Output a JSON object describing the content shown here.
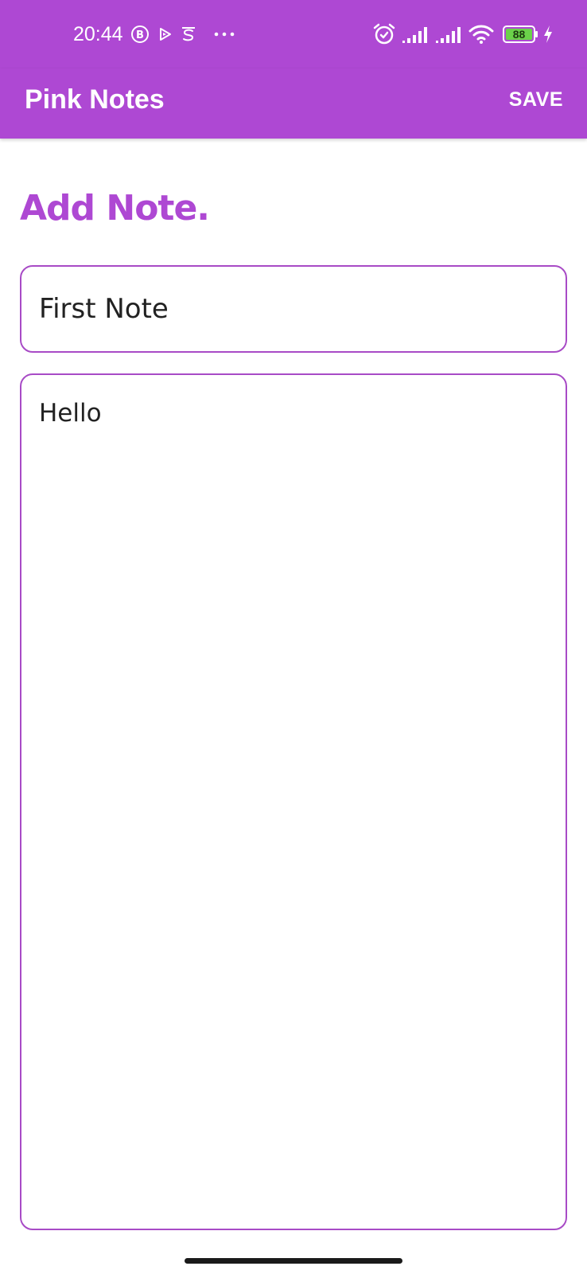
{
  "status_bar": {
    "time": "20:44",
    "battery_level": "88",
    "left_icons": [
      "b-circle-icon",
      "play-store-icon",
      "s-app-icon",
      "more-dots-icon"
    ],
    "right_icons": [
      "alarm-icon",
      "signal-icon",
      "signal-icon",
      "wifi-icon",
      "battery-icon",
      "charging-bolt-icon"
    ]
  },
  "app_bar": {
    "title": "Pink Notes",
    "save_label": "SAVE"
  },
  "page": {
    "heading": "Add Note."
  },
  "note": {
    "title_value": "First Note",
    "body_value": "Hello"
  },
  "colors": {
    "primary": "#AE48D3",
    "field_border": "#A84BC6",
    "battery_fill": "#6BD24A",
    "text": "#222222"
  }
}
